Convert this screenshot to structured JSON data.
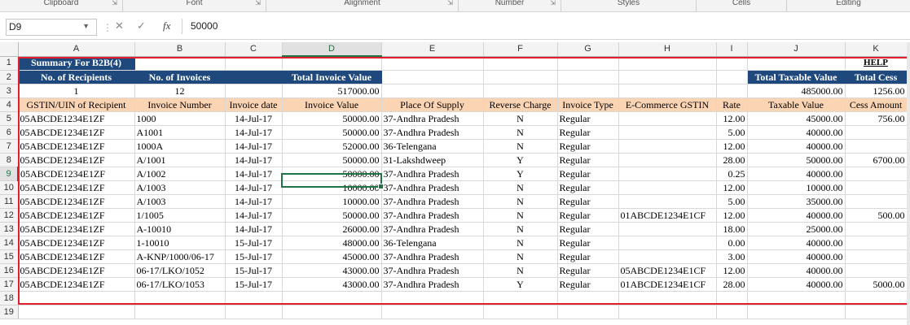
{
  "ribbon": {
    "groups": [
      "Clipboard",
      "Font",
      "Alignment",
      "Number",
      "Styles",
      "Cells",
      "Editing"
    ]
  },
  "formula_bar": {
    "name_box": "D9",
    "formula": "50000",
    "fx_label": "fx"
  },
  "column_headers": [
    "A",
    "B",
    "C",
    "D",
    "E",
    "F",
    "G",
    "H",
    "I",
    "J",
    "K"
  ],
  "row_numbers": [
    "1",
    "2",
    "3",
    "4",
    "5",
    "6",
    "7",
    "8",
    "9",
    "10",
    "11",
    "12",
    "13",
    "14",
    "15",
    "16",
    "17",
    "18",
    "19"
  ],
  "summary": {
    "title": "Summary For B2B(4)",
    "help": "HELP",
    "labels": {
      "recipients": "No. of Recipients",
      "invoices": "No. of Invoices",
      "total_invoice_value": "Total Invoice Value",
      "total_taxable_value": "Total Taxable Value",
      "total_cess": "Total Cess"
    },
    "values": {
      "recipients": "1",
      "invoices": "12",
      "total_invoice_value": "517000.00",
      "total_taxable_value": "485000.00",
      "total_cess": "1256.00"
    }
  },
  "table": {
    "headers": [
      "GSTIN/UIN of Recipient",
      "Invoice Number",
      "Invoice date",
      "Invoice Value",
      "Place Of Supply",
      "Reverse Charge",
      "Invoice Type",
      "E-Commerce GSTIN",
      "Rate",
      "Taxable Value",
      "Cess Amount"
    ],
    "rows": [
      [
        "05ABCDE1234E1ZF",
        "1000",
        "14-Jul-17",
        "50000.00",
        "37-Andhra Pradesh",
        "N",
        "Regular",
        "",
        "12.00",
        "45000.00",
        "756.00"
      ],
      [
        "05ABCDE1234E1ZF",
        "A1001",
        "14-Jul-17",
        "50000.00",
        "37-Andhra Pradesh",
        "N",
        "Regular",
        "",
        "5.00",
        "40000.00",
        ""
      ],
      [
        "05ABCDE1234E1ZF",
        "1000A",
        "14-Jul-17",
        "52000.00",
        "36-Telengana",
        "N",
        "Regular",
        "",
        "12.00",
        "40000.00",
        ""
      ],
      [
        "05ABCDE1234E1ZF",
        "A/1001",
        "14-Jul-17",
        "50000.00",
        "31-Lakshdweep",
        "Y",
        "Regular",
        "",
        "28.00",
        "50000.00",
        "6700.00"
      ],
      [
        "05ABCDE1234E1ZF",
        "A/1002",
        "14-Jul-17",
        "50000.00",
        "37-Andhra Pradesh",
        "Y",
        "Regular",
        "",
        "0.25",
        "40000.00",
        ""
      ],
      [
        "05ABCDE1234E1ZF",
        "A/1003",
        "14-Jul-17",
        "10000.00",
        "37-Andhra Pradesh",
        "N",
        "Regular",
        "",
        "12.00",
        "10000.00",
        ""
      ],
      [
        "05ABCDE1234E1ZF",
        "A/1003",
        "14-Jul-17",
        "10000.00",
        "37-Andhra Pradesh",
        "N",
        "Regular",
        "",
        "5.00",
        "35000.00",
        ""
      ],
      [
        "05ABCDE1234E1ZF",
        "1/1005",
        "14-Jul-17",
        "50000.00",
        "37-Andhra Pradesh",
        "N",
        "Regular",
        "01ABCDE1234E1CF",
        "12.00",
        "40000.00",
        "500.00"
      ],
      [
        "05ABCDE1234E1ZF",
        "A-10010",
        "14-Jul-17",
        "26000.00",
        "37-Andhra Pradesh",
        "N",
        "Regular",
        "",
        "18.00",
        "25000.00",
        ""
      ],
      [
        "05ABCDE1234E1ZF",
        "1-10010",
        "15-Jul-17",
        "48000.00",
        "36-Telengana",
        "N",
        "Regular",
        "",
        "0.00",
        "40000.00",
        ""
      ],
      [
        "05ABCDE1234E1ZF",
        "A-KNP/1000/06-17",
        "15-Jul-17",
        "45000.00",
        "37-Andhra Pradesh",
        "N",
        "Regular",
        "",
        "3.00",
        "40000.00",
        ""
      ],
      [
        "05ABCDE1234E1ZF",
        "06-17/LKO/1052",
        "15-Jul-17",
        "43000.00",
        "37-Andhra Pradesh",
        "N",
        "Regular",
        "05ABCDE1234E1CF",
        "12.00",
        "40000.00",
        ""
      ],
      [
        "05ABCDE1234E1ZF",
        "06-17/LKO/1053",
        "15-Jul-17",
        "43000.00",
        "37-Andhra Pradesh",
        "Y",
        "Regular",
        "01ABCDE1234E1CF",
        "28.00",
        "40000.00",
        "5000.00"
      ]
    ]
  },
  "selected": {
    "column": "D",
    "row": "9"
  },
  "colors": {
    "header_navy": "#1f497d",
    "header_peach": "#fbd4b4",
    "highlight_border": "#e41f2d",
    "selection": "#217346",
    "help_link": "#7030a0"
  }
}
